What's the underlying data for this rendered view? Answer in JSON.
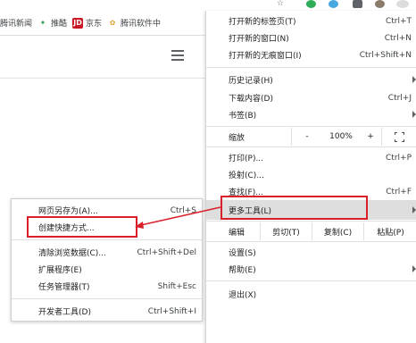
{
  "bookmarks": [
    {
      "label": "腾讯新闻",
      "icon": "news-icon"
    },
    {
      "label": "推酷",
      "icon": "tuicool-icon",
      "color": "#2e9a5c"
    },
    {
      "label": "京东",
      "icon": "jd-icon",
      "icon_text": "JD",
      "color": "#c91623"
    },
    {
      "label": "腾讯软件中",
      "icon": "flower-icon",
      "color": "#e0a33b"
    }
  ],
  "menu": {
    "new_tab": {
      "label": "打开新的标签页(T)",
      "shortcut": "Ctrl+T"
    },
    "new_window": {
      "label": "打开新的窗口(N)",
      "shortcut": "Ctrl+N"
    },
    "incognito": {
      "label": "打开新的无痕窗口(I)",
      "shortcut": "Ctrl+Shift+N"
    },
    "history": {
      "label": "历史记录(H)"
    },
    "downloads": {
      "label": "下载内容(D)",
      "shortcut": "Ctrl+J"
    },
    "bookmarks": {
      "label": "书签(B)"
    },
    "zoom": {
      "label": "缩放",
      "minus": "-",
      "value": "100%",
      "plus": "+"
    },
    "print": {
      "label": "打印(P)...",
      "shortcut": "Ctrl+P"
    },
    "cast": {
      "label": "投射(C)..."
    },
    "find": {
      "label": "查找(F)...",
      "shortcut": "Ctrl+F"
    },
    "more_tools": {
      "label": "更多工具(L)"
    },
    "edit": {
      "label": "编辑",
      "cut": "剪切(T)",
      "copy": "复制(C)",
      "paste": "粘贴(P)"
    },
    "settings": {
      "label": "设置(S)"
    },
    "help": {
      "label": "帮助(E)"
    },
    "exit": {
      "label": "退出(X)"
    }
  },
  "submenu": {
    "save_as": {
      "label": "网页另存为(A)...",
      "shortcut": "Ctrl+S"
    },
    "create_shortcut": {
      "label": "创建快捷方式..."
    },
    "clear_data": {
      "label": "清除浏览数据(C)...",
      "shortcut": "Ctrl+Shift+Del"
    },
    "extensions": {
      "label": "扩展程序(E)"
    },
    "task_manager": {
      "label": "任务管理器(T)",
      "shortcut": "Shift+Esc"
    },
    "dev_tools": {
      "label": "开发者工具(D)",
      "shortcut": "Ctrl+Shift+I"
    }
  },
  "colors": {
    "highlight": "#dedede",
    "annotation": "#d9202a"
  }
}
